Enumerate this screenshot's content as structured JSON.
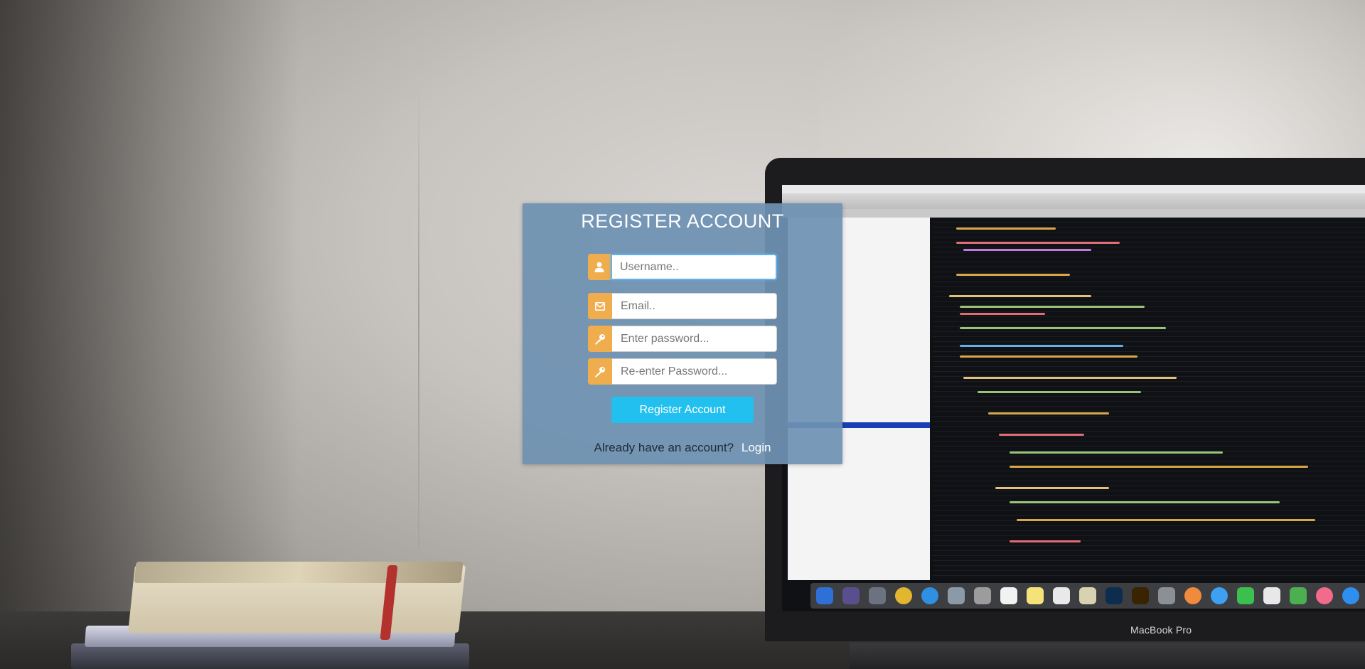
{
  "form": {
    "title": "REGISTER ACCOUNT",
    "fields": [
      {
        "placeholder": "Username..",
        "value": "",
        "icon": "user-icon"
      },
      {
        "placeholder": "Email..",
        "value": "",
        "icon": "envelope-icon"
      },
      {
        "placeholder": "Enter password...",
        "value": "",
        "icon": "key-icon"
      },
      {
        "placeholder": "Re-enter Password...",
        "value": "",
        "icon": "key-icon"
      }
    ],
    "submit_label": "Register Account",
    "login_prompt": "Already have an account?",
    "login_link": "Login"
  },
  "background": {
    "laptop_brand": "MacBook Pro"
  },
  "colors": {
    "panel": "#6e91b2",
    "addon": "#f0ad4e",
    "button": "#22c0ef",
    "focus": "#66afe9"
  }
}
